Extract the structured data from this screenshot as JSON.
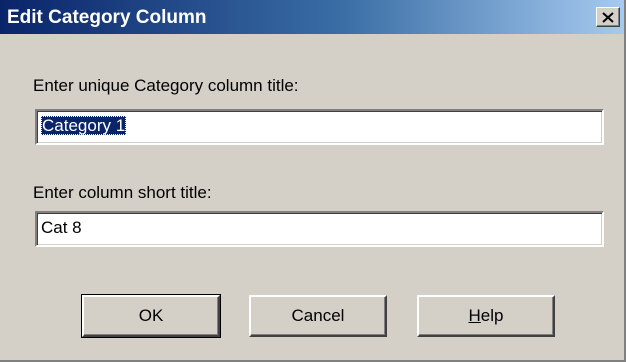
{
  "window": {
    "title": "Edit Category Column",
    "close_glyph": "×"
  },
  "form": {
    "title_label": "Enter unique Category column title:",
    "title_value": "Category 1",
    "short_label": "Enter column short title:",
    "short_value": "Cat 8"
  },
  "buttons": {
    "ok": "OK",
    "cancel": "Cancel",
    "help_mnemonic": "H",
    "help_rest": "elp"
  },
  "colors": {
    "face": "#d4d0c8",
    "title_start": "#0a246a",
    "title_end": "#a6caf0",
    "selection": "#0a246a"
  }
}
